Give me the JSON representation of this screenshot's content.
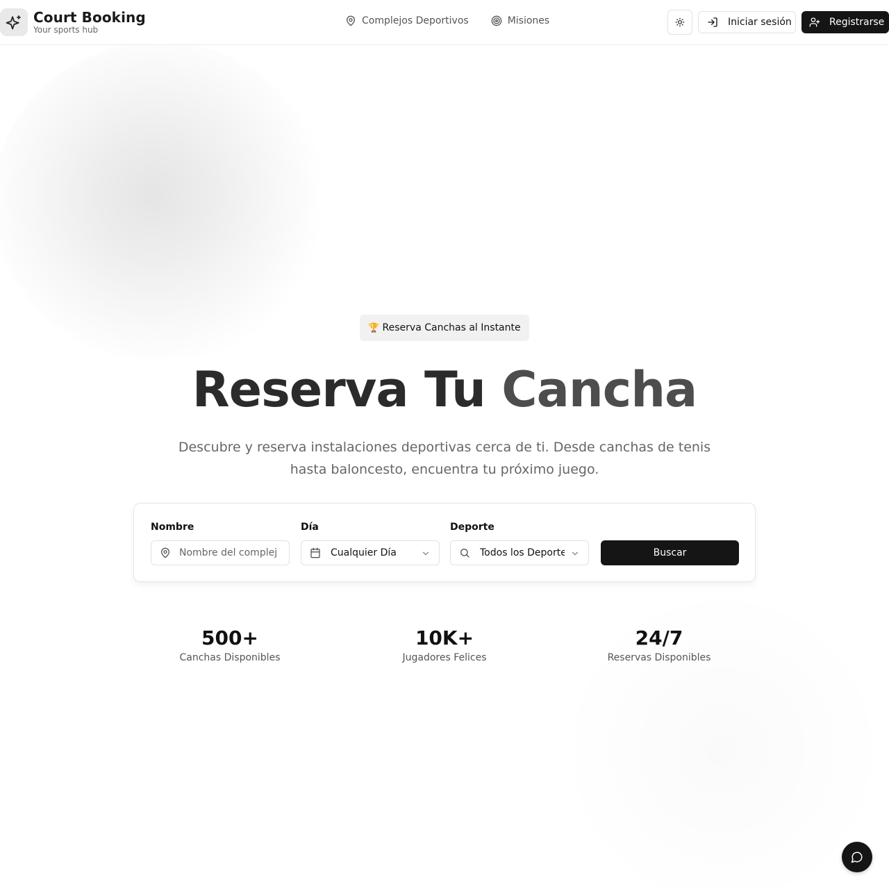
{
  "header": {
    "brand_title": "Court Booking",
    "brand_subtitle": "Your sports hub",
    "nav": [
      {
        "label": "Complejos Deportivos",
        "icon": "map-pin-icon"
      },
      {
        "label": "Misiones",
        "icon": "target-icon"
      }
    ],
    "theme_toggle_icon": "sun-icon",
    "login_label": "Iniciar sesión",
    "register_label": "Registrarse"
  },
  "hero": {
    "badge_icon": "🏆",
    "badge_text": "Reserva Canchas al Instante",
    "title_part1": "Reserva Tu",
    "title_part2": "Cancha",
    "description": "Descubre y reserva instalaciones deportivas cerca de ti. Desde canchas de tenis hasta baloncesto, encuentra tu próximo juego."
  },
  "search": {
    "name_label": "Nombre",
    "name_placeholder": "Nombre del complejo",
    "day_label": "Día",
    "day_value": "Cualquier Día",
    "sport_label": "Deporte",
    "sport_value": "Todos los Deportes",
    "search_button": "Buscar"
  },
  "stats": [
    {
      "value": "500+",
      "label": "Canchas Disponibles"
    },
    {
      "value": "10K+",
      "label": "Jugadores Felices"
    },
    {
      "value": "24/7",
      "label": "Reservas Disponibles"
    }
  ],
  "colors": {
    "primary_dark": "#151515",
    "muted_text": "#666666",
    "border": "#e2e2e2"
  }
}
